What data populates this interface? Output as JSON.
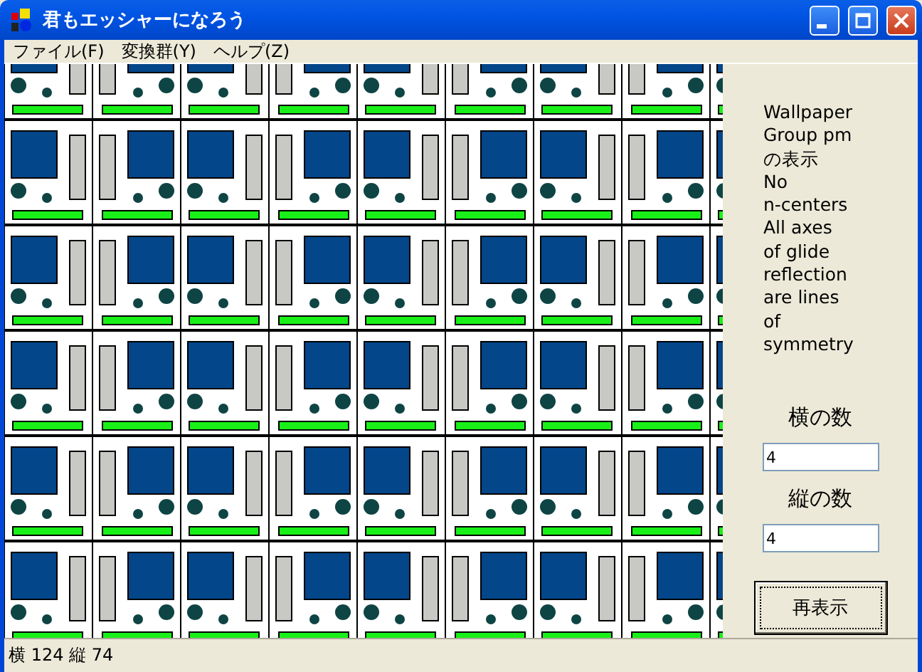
{
  "window": {
    "title": "君もエッシャーになろう"
  },
  "menu": [
    {
      "label": "ファイル(F)"
    },
    {
      "label": "変換群(Y)"
    },
    {
      "label": "ヘルプ(Z)"
    }
  ],
  "panel": {
    "heading_lines": [
      "Wallpaper",
      "Group pm",
      "の表示"
    ],
    "description_lines": [
      "No",
      "n-centers",
      "All axes",
      "of glide",
      "reflection",
      "are lines",
      "of",
      "symmetry"
    ],
    "fields": [
      {
        "label": "横の数",
        "value": "4"
      },
      {
        "label": "縦の数",
        "value": "4"
      }
    ],
    "button": "再表示"
  },
  "status_bar": "横 124 縦 74"
}
